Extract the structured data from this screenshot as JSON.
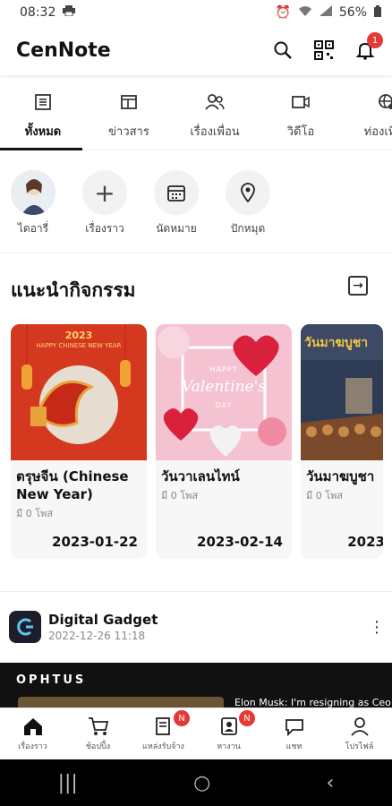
{
  "status": {
    "time": "08:32",
    "battery": "56%"
  },
  "app": {
    "title": "CenNote",
    "notification_count": "1"
  },
  "tabs": [
    {
      "label": "ทั้งหมด",
      "icon": "list-icon",
      "active": true
    },
    {
      "label": "ข่าวสาร",
      "icon": "news-icon"
    },
    {
      "label": "เรื่องเพื่อน",
      "icon": "friends-icon"
    },
    {
      "label": "วิดีโอ",
      "icon": "video-icon"
    },
    {
      "label": "ท่องเที่ยว",
      "icon": "travel-icon"
    }
  ],
  "shortcuts": [
    {
      "label": "ไดอารี่",
      "icon": "avatar"
    },
    {
      "label": "เรื่องราว",
      "icon": "plus-icon"
    },
    {
      "label": "นัดหมาย",
      "icon": "calendar-icon"
    },
    {
      "label": "ปักหมุด",
      "icon": "pin-icon"
    }
  ],
  "section": {
    "title": "แนะนำกิจกรรม"
  },
  "activities": [
    {
      "title": "ตรุษจีน (Chinese New Year)",
      "sub": "มี 0 โพส",
      "date": "2023-01-22",
      "banner": "HAPPY CHINESE NEW YEAR",
      "year": "2023"
    },
    {
      "title": "วันวาเลนไทน์",
      "sub": "มี 0 โพส",
      "date": "2023-02-14",
      "banner": "Valentine's",
      "banner_top": "HAPPY",
      "banner_bottom": "DAY"
    },
    {
      "title": "วันมาฆบูชา",
      "sub": "มี 0 โพส",
      "date": "2023",
      "banner": "วันมาฆบูชา"
    }
  ],
  "post": {
    "name": "Digital Gadget",
    "time": "2022-12-26 11:18",
    "media_brand": "OPHTUS",
    "media_caption": "Elon Musk: I'm resigning as Ceo of"
  },
  "bottom_nav": [
    {
      "label": "เรื่องราว",
      "icon": "home-icon",
      "badge": ""
    },
    {
      "label": "ช้อปปิ้ง",
      "icon": "cart-icon",
      "badge": ""
    },
    {
      "label": "แหล่งรับจ้าง",
      "icon": "job-icon",
      "badge": "N"
    },
    {
      "label": "หางาน",
      "icon": "resume-icon",
      "badge": "N"
    },
    {
      "label": "แชท",
      "icon": "chat-icon",
      "badge": ""
    },
    {
      "label": "โปรไฟล์",
      "icon": "profile-icon",
      "badge": ""
    }
  ],
  "colors": {
    "accent": "#e53935",
    "media_bg": "#111111"
  }
}
